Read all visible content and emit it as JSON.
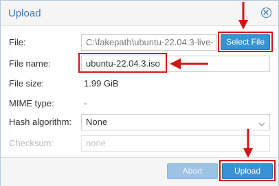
{
  "dialog": {
    "title": "Upload"
  },
  "form": {
    "file": {
      "label": "File:",
      "value": "C:\\fakepath\\ubuntu-22.04.3-live-",
      "button_label": "Select File"
    },
    "file_name": {
      "label": "File name:",
      "value": "ubuntu-22.04.3.iso"
    },
    "file_size": {
      "label": "File size:",
      "value": "1.99 GiB"
    },
    "mime_type": {
      "label": "MIME type:",
      "value": "-"
    },
    "hash_algorithm": {
      "label": "Hash algorithm:",
      "value": "None"
    },
    "checksum": {
      "label": "Checksum:",
      "placeholder": "none"
    }
  },
  "footer": {
    "abort_label": "Abort",
    "upload_label": "Upload"
  },
  "colors": {
    "accent": "#3892d4",
    "title": "#3a78b8",
    "annotation": "#d01515"
  }
}
